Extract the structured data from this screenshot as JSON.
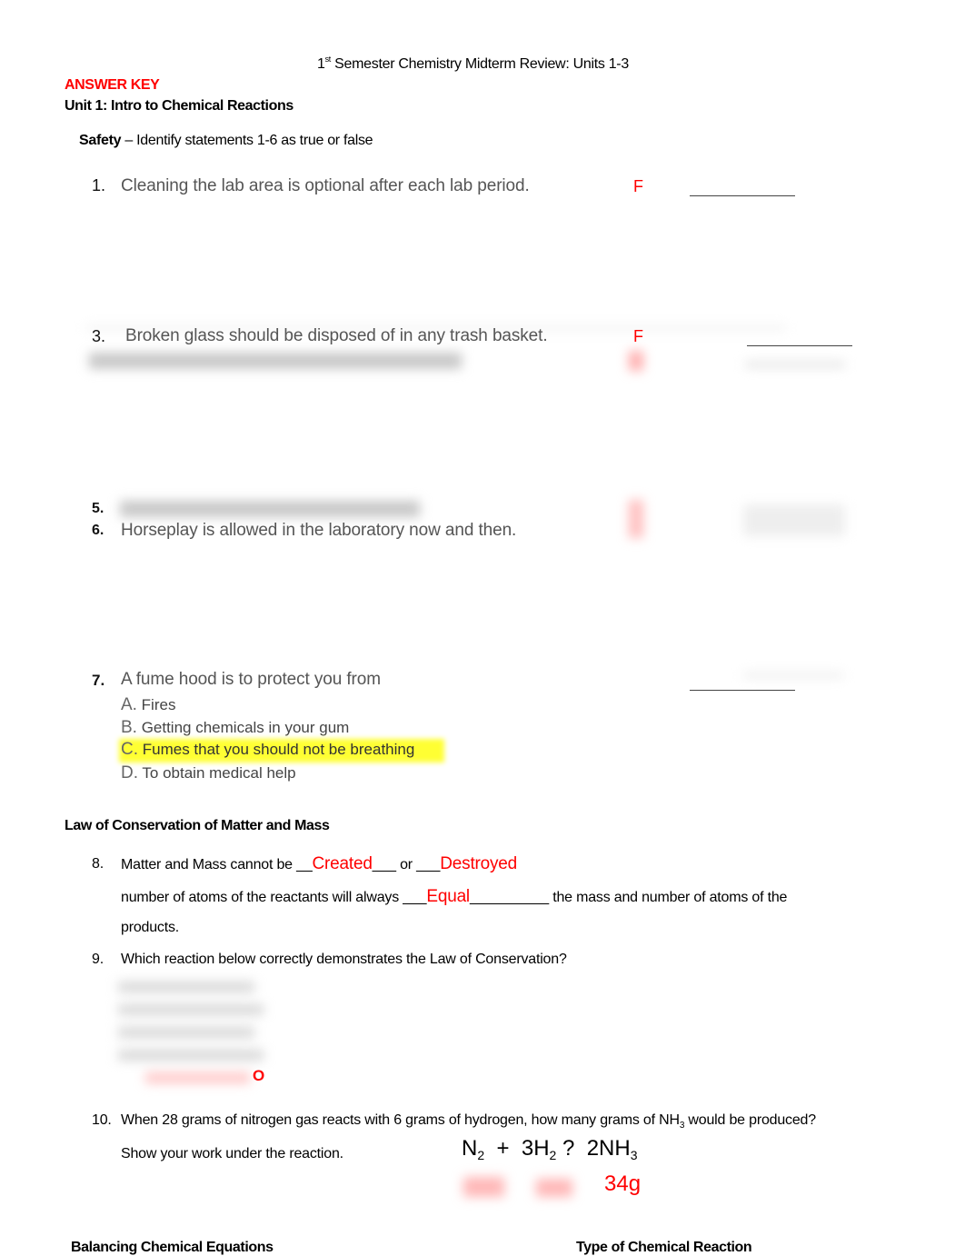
{
  "document": {
    "title_prefix": "1",
    "title_sup": "st",
    "title_rest": " Semester Chemistry Midterm Review:  Units 1-3",
    "answer_key": "ANSWER KEY",
    "unit_heading": "Unit 1: Intro to Chemical Reactions"
  },
  "safety": {
    "label": "Safety",
    "instructions": " – Identify statements 1-6 as true or false",
    "questions": [
      {
        "num": "1.",
        "text": "Cleaning the lab area is optional after each lab period.",
        "answer": "F"
      },
      {
        "num": "3.",
        "text": "Broken glass should be disposed of in any trash basket.",
        "answer": "F"
      },
      {
        "num": "5.",
        "text": "",
        "answer": ""
      },
      {
        "num": "6.",
        "text": "Horseplay is allowed in the laboratory now and then.",
        "answer": ""
      }
    ],
    "q7": {
      "num": "7.",
      "text": "A fume hood is to protect you from",
      "options": [
        {
          "letter": "A.",
          "text": " Fires"
        },
        {
          "letter": "B.",
          "text": "Getting chemicals in your gum"
        },
        {
          "letter": "C.",
          "text": "Fumes that you should not be breathing",
          "highlighted": true
        },
        {
          "letter": "D.",
          "text": "To obtain medical help"
        }
      ]
    }
  },
  "conservation": {
    "heading": "Law of Conservation of Matter and Mass",
    "q8": {
      "num": "8.",
      "part1": "Matter and Mass cannot be __",
      "answer1": "Created",
      "part2": "___ or ___",
      "answer2": "Destroyed",
      "line2_pre": "number of atoms of the reactants will always  ___",
      "answer3": "Equal",
      "line2_post": "__________ the mass and number of atoms of the",
      "line3": "products."
    },
    "q9": {
      "num": "9.",
      "text": "Which reaction below correctly demonstrates the Law of Conservation?",
      "mark": "O"
    },
    "q10": {
      "num": "10.",
      "text_pre": "When 28 grams of nitrogen gas reacts with 6 grams of hydrogen, how many grams of NH",
      "text_sub": "3",
      "text_post": " would be produced?",
      "line2": "Show your work under the reaction.",
      "equation": {
        "n": "N",
        "n_sub": "2",
        "plus": "+",
        "h": "3H",
        "h_sub": "2",
        "arrow": "?",
        "p": "2NH",
        "p_sub": "3"
      },
      "answer": "34g"
    }
  },
  "footer_headings": {
    "left": "Balancing Chemical Equations",
    "right": "Type of Chemical Reaction"
  }
}
